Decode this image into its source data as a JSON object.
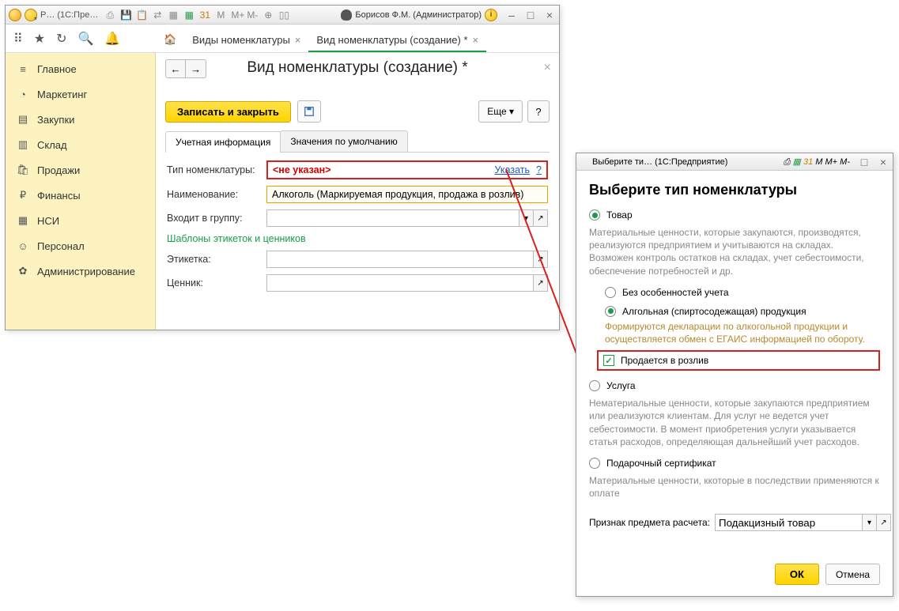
{
  "main_window": {
    "title_trunc": "Р… (1С:Пре…",
    "user": "Борисов Ф.М. (Администратор)",
    "window_tabs": {
      "home": "⌂",
      "tab1": "Виды номенклатуры",
      "tab2": "Вид номенклатуры  (создание) *"
    },
    "sidebar": [
      {
        "icon": "≡",
        "label": "Главное"
      },
      {
        "icon": "◔",
        "label": "Маркетинг"
      },
      {
        "icon": "▤",
        "label": "Закупки"
      },
      {
        "icon": "▥",
        "label": "Склад"
      },
      {
        "icon": "🛍",
        "label": "Продажи"
      },
      {
        "icon": "₽",
        "label": "Финансы"
      },
      {
        "icon": "▦",
        "label": "НСИ"
      },
      {
        "icon": "☺",
        "label": "Персонал"
      },
      {
        "icon": "✿",
        "label": "Администрирование"
      }
    ],
    "page": {
      "title": "Вид номенклатуры  (создание) *",
      "save_close": "Записать и закрыть",
      "more": "Еще",
      "help": "?",
      "tabs": {
        "t1": "Учетная информация",
        "t2": "Значения по умолчанию"
      },
      "form": {
        "type_label": "Тип номенклатуры:",
        "type_value": "<не указан>",
        "type_link": "Указать",
        "type_q": "?",
        "name_label": "Наименование:",
        "name_value": "Алкоголь (Маркируемая продукция, продажа в розлив)",
        "group_label": "Входит в группу:",
        "section": "Шаблоны этикеток и ценников",
        "etik_label": "Этикетка:",
        "price_label": "Ценник:"
      }
    }
  },
  "dialog": {
    "win_title": "Выберите ти… (1С:Предприятие)",
    "heading": "Выберите тип номенклатуры",
    "tovar": {
      "label": "Товар",
      "desc": "Материальные ценности, которые закупаются, производятся, реализуются предприятием и учитываются на складах. Возможен контроль остатков на складах, учет себестоимости, обеспечение потребностей и др."
    },
    "sub1": {
      "label": "Без особенностей учета"
    },
    "sub2": {
      "label": "Алгольная (спиртосодежащая) продукция",
      "desc": "Формируются декларации по алкогольной продукции и осуществляется обмен с ЕГАИС информацией по обороту."
    },
    "chk": {
      "label": "Продается в розлив"
    },
    "usluga": {
      "label": "Услуга",
      "desc": "Нематериальные ценности, которые закупаются предприятием или реализуются клиентам. Для услуг не ведется учет себестоимости. В момент приобретения услуги указывается статья расходов, определяющая дальнейший учет расходов."
    },
    "cert": {
      "label": "Подарочный сертификат",
      "desc": "Материальные ценности, ккоторые в последствии применяются к оплате"
    },
    "priznak": {
      "label": "Признак предмета расчета:",
      "value": "Подакцизный товар"
    },
    "ok": "ОК",
    "cancel": "Отмена"
  }
}
